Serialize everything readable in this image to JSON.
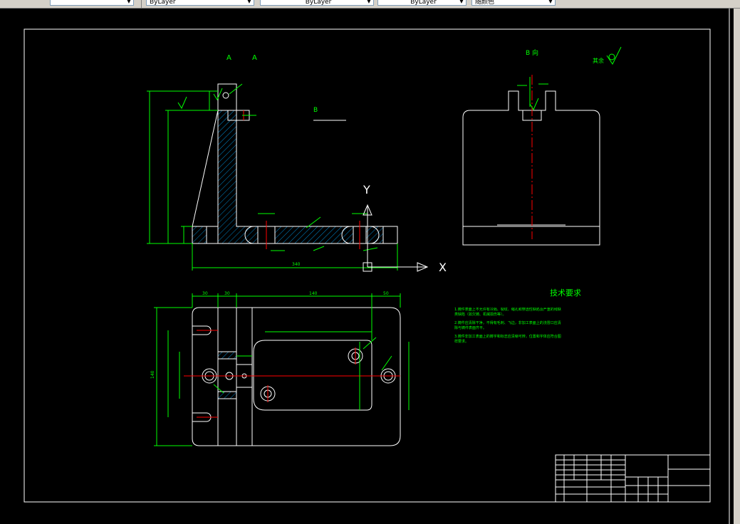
{
  "toolbar": {
    "style_value": "",
    "color_value": "ByLayer",
    "linetype_value": "ByLayer",
    "lineweight_value": "ByLayer",
    "plotstyle_value": "随颜色"
  },
  "view_labels": {
    "section_a1": "A",
    "section_a2": "A",
    "view_b_left": "B",
    "view_b_right": "B 向",
    "other_roughness": "其余"
  },
  "axis_labels": {
    "y": "Y",
    "x": "X"
  },
  "dims": {
    "front_total_width": "340",
    "plan_dim_30a": "30",
    "plan_dim_30b": "30",
    "plan_dim_140": "140",
    "plan_dim_50": "50",
    "plan_dim_overall_h": "140"
  },
  "tech_requirements": {
    "title": "技术要求",
    "item1": "1.铸件表面上不允许有冷隔、裂纹、缩孔和穿透性缺陷及严重的残缺类缺陷（如欠铸、机械损伤等）。",
    "item2": "2.铸件应清除干净，不得有毛刺、飞边，非加工表面上的浇冒口应清除与铸件表面齐平。",
    "item3": "3.铸件非加工表面上的铸字和标志应清晰可辨，位置和字体应符合图样要求。"
  },
  "colors": {
    "background": "#000000",
    "geometry": "#ffffff",
    "dimension": "#00ff00",
    "centerline": "#ff0000",
    "hatch": "#00aaff"
  }
}
